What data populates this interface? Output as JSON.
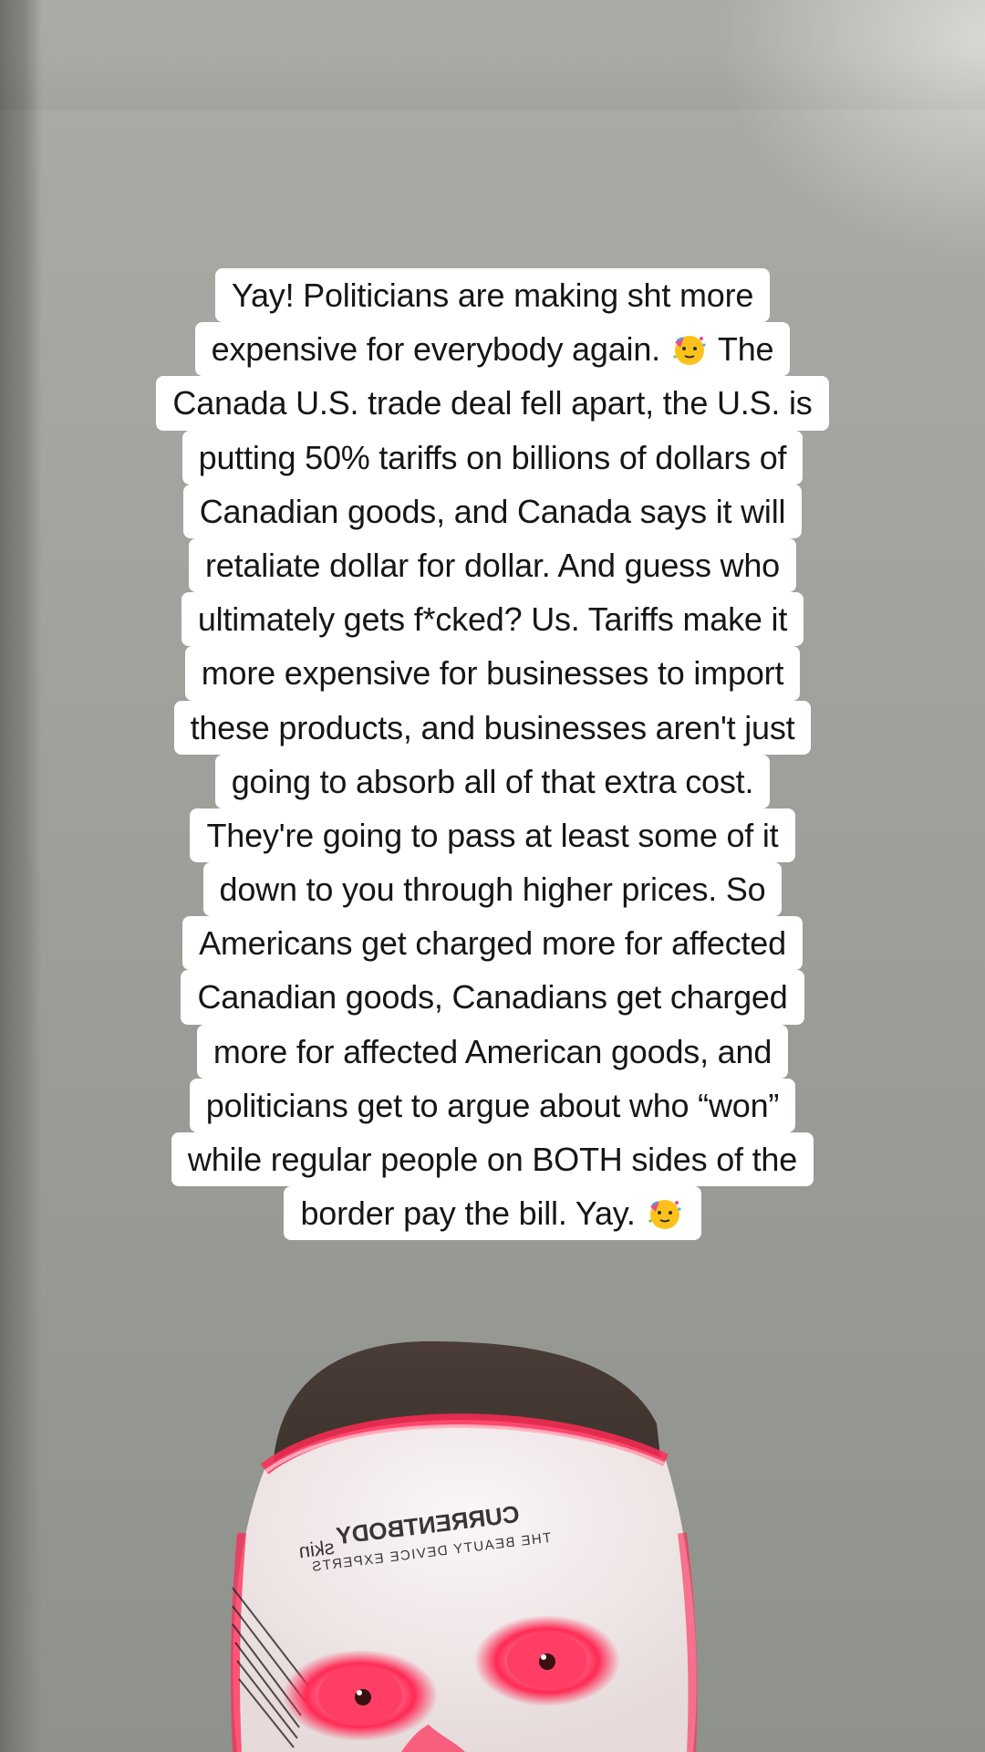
{
  "caption": {
    "lines": [
      "Yay! Politicians are making sht more",
      "expensive for everybody again.",
      "The",
      "Canada U.S. trade deal fell apart, the U.S. is",
      "putting 50% tariffs on billions of dollars of",
      "Canadian goods, and Canada says it will",
      "retaliate dollar for dollar. And guess who",
      "ultimately gets f*cked? Us. Tariffs make it",
      "more expensive for businesses to import",
      "these products, and businesses aren't just",
      "going to absorb all of that extra cost.",
      "They're going to pass at least some of it",
      "down to you through higher prices. So",
      "Americans get charged more for affected",
      "Canadian goods, Canadians get charged",
      "more for affected American goods, and",
      "politicians get to argue about who “won”",
      "while regular people on BOTH sides of the",
      "border pay the bill. Yay."
    ],
    "emoji_icon": "partying-face-emoji"
  },
  "mask": {
    "brand_line1": "CURRENTBODY",
    "brand_line1_suffix": "skin",
    "brand_line2": "THE BEAUTY DEVICE EXPERTS",
    "glow_color": "#ff2a55",
    "mask_color": "#f4eeee"
  }
}
